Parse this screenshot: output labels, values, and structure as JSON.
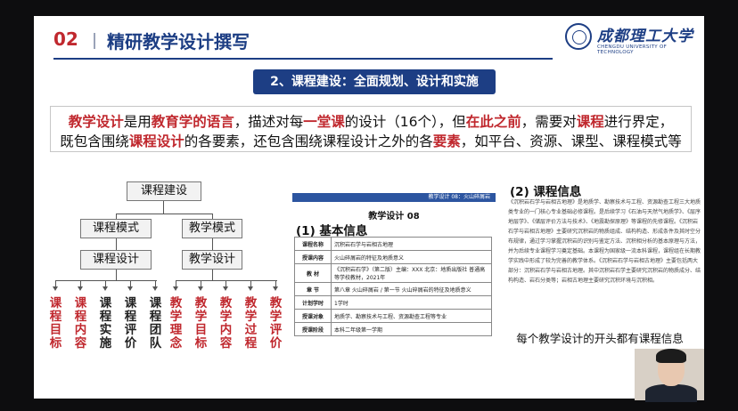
{
  "header": {
    "number": "02",
    "title": "精研教学设计撰写"
  },
  "logo": {
    "cn": "成都理工大学",
    "en": "CHENGDU UNIVERSITY OF TECHNOLOGY"
  },
  "banner": "2、课程建设：全面规划、设计和实施",
  "desc": {
    "l1": [
      "教学设计",
      "是用",
      "教育学的语言",
      "，描述对每",
      "一堂课",
      "的设计（16个），但",
      "在此之前",
      "，需要对",
      "课程",
      "进行界定，"
    ],
    "l2": [
      "既包含围绕",
      "课程设计",
      "的各要素，还包含围绕课程设计之外的各",
      "要素",
      "，如平台、资源、课型、课程模式等"
    ]
  },
  "tree": {
    "root": "课程建设",
    "left": "课程模式",
    "right": "教学模式",
    "left_sub": "课程设计",
    "right_sub": "教学设计",
    "leaves": [
      {
        "label": "课程目标",
        "color": "#c0282e"
      },
      {
        "label": "课程内容",
        "color": "#c0282e"
      },
      {
        "label": "课程实施",
        "color": "#222222"
      },
      {
        "label": "课程评价",
        "color": "#222222"
      },
      {
        "label": "课程团队",
        "color": "#222222"
      },
      {
        "label": "教学理念",
        "color": "#c0282e"
      },
      {
        "label": "教学目标",
        "color": "#c0282e"
      },
      {
        "label": "教学内容",
        "color": "#c0282e"
      },
      {
        "label": "教学过程",
        "color": "#c0282e"
      },
      {
        "label": "教学评价",
        "color": "#c0282e"
      }
    ]
  },
  "doc": {
    "bar": "教学设计 08：火山碎屑岩",
    "title": "教学设计 08",
    "section1": "(1) 基本信息",
    "rows": [
      [
        "课程名称",
        "沉积岩石学与岩相古地理"
      ],
      [
        "授课内容",
        "火山碎屑岩的特征及地质意义"
      ],
      [
        "教 材",
        "《沉积岩石学》（第二版）主编：XXX 北京：地质出版社 普通高等学校教材，2021年"
      ],
      [
        "章 节",
        "第八章 火山碎屑岩 / 第一节 火山碎屑岩的特征及地质意义"
      ],
      [
        "计划学时",
        "1学时"
      ],
      [
        "授课对象",
        "地质学、勘察技术与工程、资源勘查工程等专业"
      ],
      [
        "授课阶段",
        "本科二年级第一学期"
      ]
    ]
  },
  "section2": "(2) 课程信息",
  "paragraph": "《沉积岩石学与岩相古地理》是地质学、勘察技术与工程、资源勘查工程三大地质类专业的一门核心专业基础必修课程。是后续学习《石油与天然气地质学》、《层序地层学》、《储层评价方法与技术》、《地震勘探原理》等课程的先修课程。《沉积岩石学与岩相古地理》主要研究沉积岩的物质组成、结构构造、形成条件及其时空分布规律，通过学习掌握沉积岩的识别与鉴定方法、沉积相分析的基本原理与方法，并为后续专业课程学习奠定基础。本课程为国家级一流本科课程，课程组在长期教学实践中形成了较为完善的教学体系。《沉积岩石学与岩相古地理》主要包括两大部分：沉积岩石学与岩相古地理。其中沉积岩石学主要研究沉积岩的物质成分、结构构造、岩石分类等；岩相古地理主要研究沉积环境与沉积相。",
  "caption": "每个教学设计的开头都有课程信息"
}
